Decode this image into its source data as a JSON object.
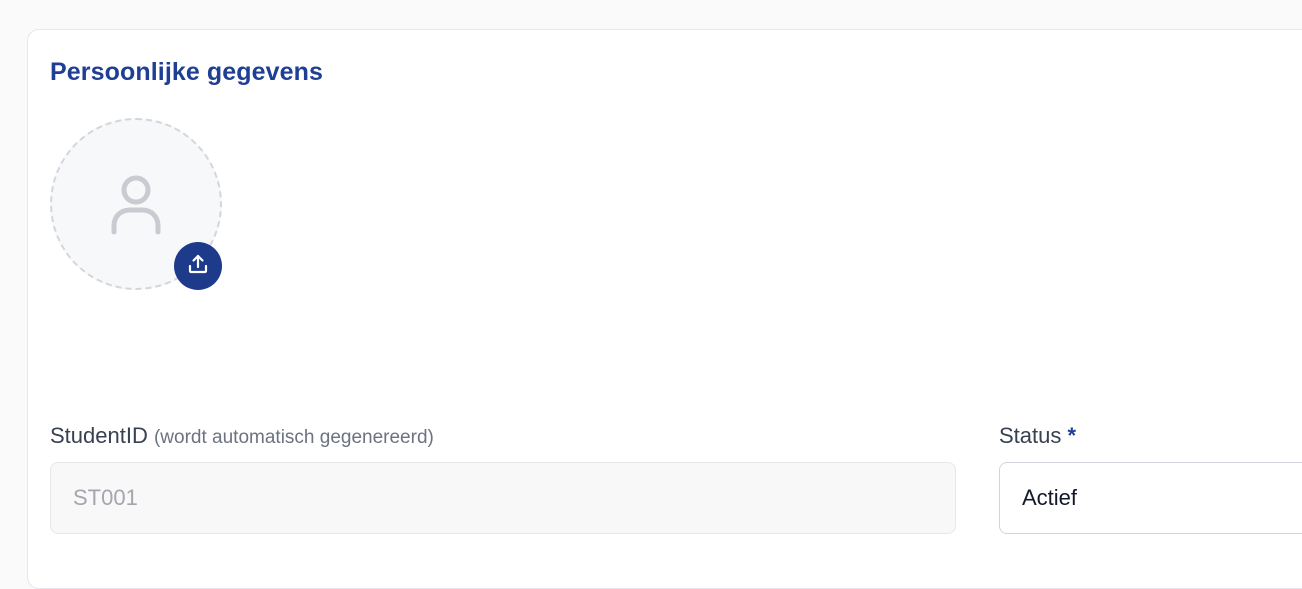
{
  "section": {
    "title": "Persoonlijke gegevens"
  },
  "avatar": {
    "placeholder_icon": "user-icon",
    "upload_icon": "upload-icon"
  },
  "fields": {
    "student_id": {
      "label": "StudentID",
      "hint": "(wordt automatisch gegenereerd)",
      "value": "ST001"
    },
    "status": {
      "label": "Status",
      "required_mark": "*",
      "value": "Actief"
    }
  },
  "colors": {
    "title": "#1e3f94",
    "upload_button": "#1e3a8a",
    "border": "#e5e7eb"
  }
}
